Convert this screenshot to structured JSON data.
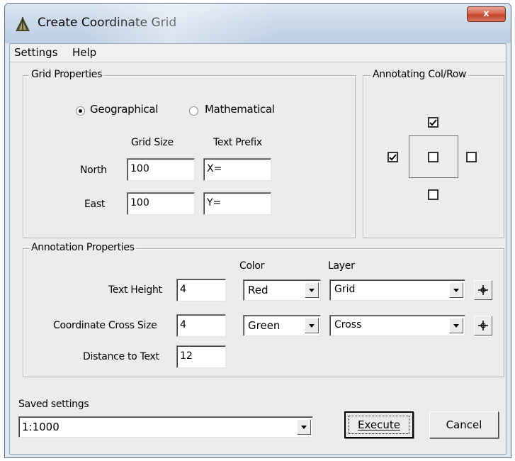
{
  "window": {
    "title": "Create Coordinate Grid",
    "close_glyph": "x"
  },
  "menu": {
    "items": [
      "Settings",
      "Help"
    ]
  },
  "grid_properties": {
    "title": "Grid Properties",
    "radio_geographical": "Geographical",
    "radio_mathematical": "Mathematical",
    "selected": "Geographical",
    "col_grid_size": "Grid Size",
    "col_text_prefix": "Text Prefix",
    "north_label": "North",
    "north_grid_size": "100",
    "north_prefix": "X=",
    "east_label": "East",
    "east_grid_size": "100",
    "east_prefix": "Y="
  },
  "annotating": {
    "title": "Annotating Col/Row",
    "top_checked": true,
    "left_checked": true,
    "center_checked": false,
    "right_checked": false,
    "bottom_checked": false
  },
  "annotation_properties": {
    "title": "Annotation Properties",
    "col_color": "Color",
    "col_layer": "Layer",
    "text_height_label": "Text Height",
    "text_height_value": "4",
    "text_height_color": "Red",
    "text_height_layer": "Grid",
    "cross_size_label": "Coordinate Cross Size",
    "cross_size_value": "4",
    "cross_size_color": "Green",
    "cross_size_layer": "Cross",
    "distance_label": "Distance to Text",
    "distance_value": "12"
  },
  "saved_settings": {
    "label": "Saved settings",
    "value": "1:1000"
  },
  "buttons": {
    "execute": "Execute",
    "cancel": "Cancel"
  },
  "colors": {
    "title_bar": "#c9d8ea",
    "close_button": "#c8472e",
    "dialog_bg": "#ececec"
  },
  "icons": {
    "app": "triangle-app-icon",
    "pick": "crosshair-pick-icon",
    "check": "checkmark-icon"
  }
}
